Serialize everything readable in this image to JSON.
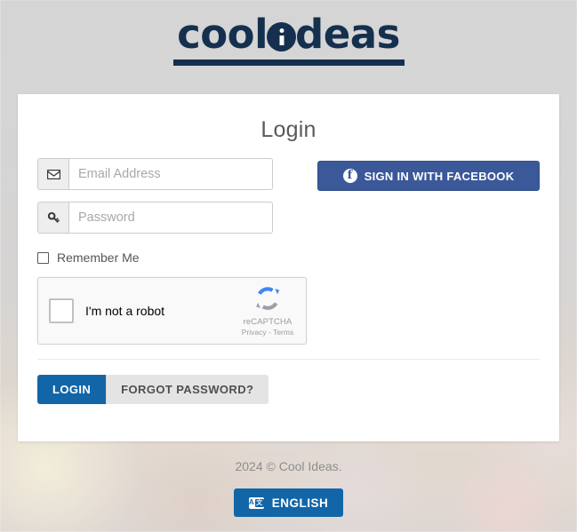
{
  "brand": {
    "logo_part1": "cool",
    "logo_icon": "i-dot-circle-icon",
    "logo_part2": "deas"
  },
  "card": {
    "title": "Login",
    "email": {
      "icon": "envelope-icon",
      "placeholder": "Email Address",
      "value": ""
    },
    "password": {
      "icon": "key-icon",
      "placeholder": "Password",
      "value": ""
    },
    "facebook_button": {
      "icon": "facebook-icon",
      "label": "SIGN IN WITH FACEBOOK",
      "color": "#3b5998"
    },
    "remember_me": {
      "label": "Remember Me",
      "checked": false
    },
    "recaptcha": {
      "label": "I'm not a robot",
      "checked": false,
      "brand_name": "reCAPTCHA",
      "privacy_label": "Privacy",
      "separator": "-",
      "terms_label": "Terms",
      "logo_icon": "recaptcha-icon"
    },
    "login_button": {
      "label": "LOGIN",
      "color": "#1266a8"
    },
    "forgot_button": {
      "label": "FORGOT PASSWORD?",
      "color": "#e4e4e4"
    }
  },
  "footer": {
    "copyright": "2024 © Cool Ideas.",
    "language_button": {
      "icon": "translate-icon",
      "glyph_a": "A",
      "glyph_b": "文",
      "label": "ENGLISH",
      "color": "#1266a8"
    }
  }
}
